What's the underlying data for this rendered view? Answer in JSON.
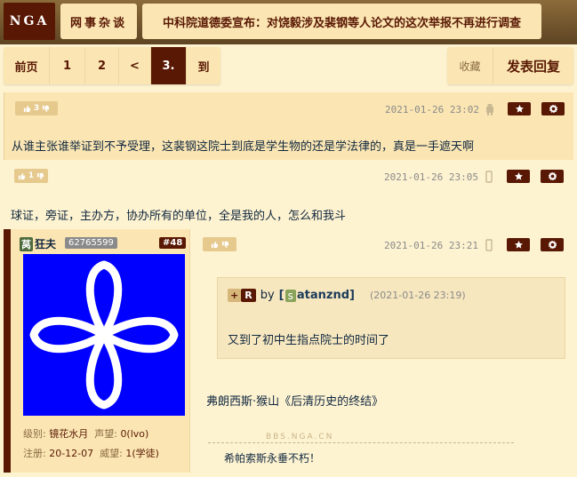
{
  "nav": {
    "logo": "NGA",
    "forum": "网事杂谈",
    "thread_title": "中科院道德委宣布：对饶毅涉及裴钢等人论文的这次举报不再进行调查"
  },
  "pager": {
    "first": "前页",
    "pages": [
      "1",
      "2"
    ],
    "prev": "<",
    "current": "3.",
    "goto": "到"
  },
  "actions": {
    "favorite": "收藏",
    "reply": "发表回复"
  },
  "posts": [
    {
      "votes": "3",
      "time": "2021-01-26 23:02",
      "device": "android-icon",
      "text": "从谁主张谁举证到不予受理，这裴钢这院士到底是学生物的还是学法律的，真是一手遮天啊"
    },
    {
      "votes": "1",
      "time": "2021-01-26 23:05",
      "device": "mobile-icon",
      "text": "球证，旁证，主办方，协办所有的单位，全是我的人，怎么和我斗"
    }
  ],
  "main_post": {
    "user": {
      "group_badge": "莴",
      "name": "狂夫",
      "uid": "62765599",
      "floor": "#48",
      "level_label": "级别:",
      "level": "镜花水月",
      "prestige_label": "声望:",
      "prestige": "0(lvo)",
      "joined_label": "注册:",
      "joined": "20-12-07",
      "reputation_label": "威望:",
      "reputation": "1(学徒)",
      "avatar_bg": "#0000ff"
    },
    "time": "2021-01-26 23:21",
    "quote": {
      "plus": "+",
      "r": "R",
      "by": "by",
      "bracket": "[",
      "user_initial": "s",
      "user": "atanznd]",
      "time": "(2021-01-26 23:19)",
      "text": "又到了初中生指点院士的时间了"
    },
    "text": "弗朗西斯·猴山《后清历史的终结》",
    "watermark": "BBS.NGA.CN",
    "signature": "希帕索斯永垂不朽！"
  },
  "colors": {
    "brand": "#591804",
    "panel": "#fbe6b3",
    "background": "#fef3d1"
  }
}
